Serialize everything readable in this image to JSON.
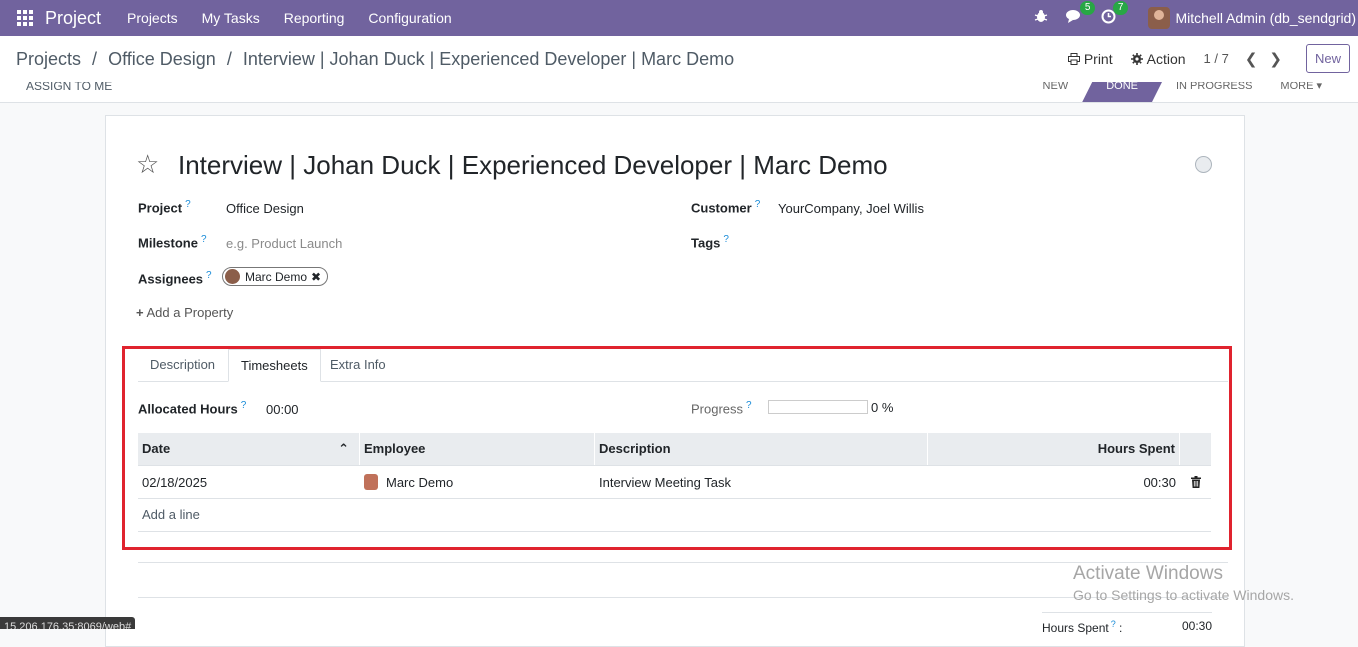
{
  "navbar": {
    "brand": "Project",
    "menu": [
      "Projects",
      "My Tasks",
      "Reporting",
      "Configuration"
    ],
    "messages_count": "5",
    "activities_count": "7",
    "user": "Mitchell Admin (db_sendgrid)"
  },
  "control_panel": {
    "breadcrumb": [
      "Projects",
      "Office Design",
      "Interview | Johan Duck | Experienced Developer | Marc Demo"
    ],
    "separator": "/",
    "print_label": "Print",
    "action_label": "Action",
    "pager": "1 / 7",
    "new_label": "New"
  },
  "statusbar": {
    "assign_label": "ASSIGN TO ME",
    "stages": [
      "NEW",
      "DONE",
      "IN PROGRESS",
      "MORE"
    ],
    "active_stage": "DONE"
  },
  "task": {
    "title": "Interview | Johan Duck | Experienced Developer | Marc Demo",
    "project_label": "Project",
    "project_value": "Office Design",
    "milestone_label": "Milestone",
    "milestone_placeholder": "e.g. Product Launch",
    "assignees_label": "Assignees",
    "assignee": "Marc Demo",
    "customer_label": "Customer",
    "customer_value": "YourCompany, Joel Willis",
    "tags_label": "Tags",
    "add_property": "Add a Property"
  },
  "tabs": [
    "Description",
    "Timesheets",
    "Extra Info"
  ],
  "timesheets": {
    "allocated_label": "Allocated Hours",
    "allocated_value": "00:00",
    "progress_label": "Progress",
    "progress_value": "0 %",
    "progress_fraction": 0,
    "columns": [
      "Date",
      "Employee",
      "Description",
      "Hours Spent"
    ],
    "rows": [
      {
        "date": "02/18/2025",
        "employee": "Marc Demo",
        "description": "Interview Meeting Task",
        "hours": "00:30"
      }
    ],
    "add_line": "Add a line",
    "hours_spent_label": "Hours Spent",
    "hours_spent_total": "00:30"
  },
  "overlay": {
    "watermark_title": "Activate Windows",
    "watermark_sub": "Go to Settings to activate Windows.",
    "status_url": "15.206.176.35:8069/web#"
  }
}
